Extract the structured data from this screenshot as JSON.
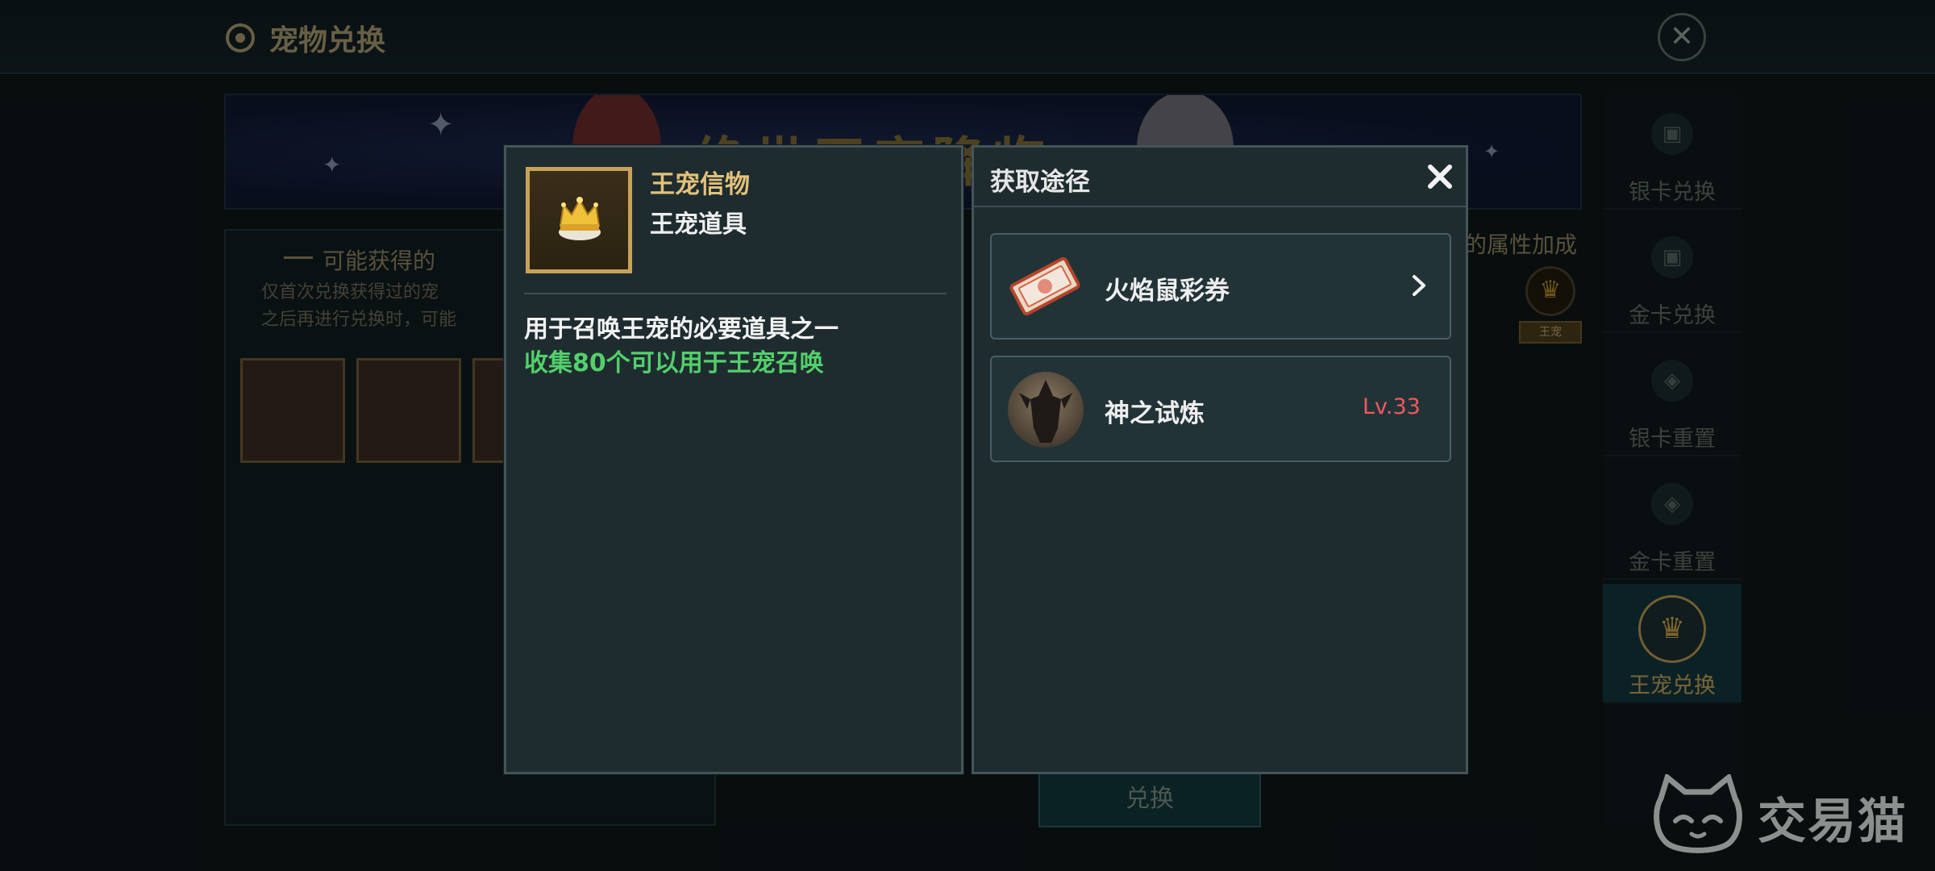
{
  "background": {
    "title": "宠物兑换",
    "banner_title": "绝世王宠降临",
    "panel_title": "可能获得的",
    "panel_note_lines": [
      "仅首次兑换获得过的宠",
      "之后再进行兑换时，可能"
    ],
    "attr_label": "的属性加成",
    "attr_tag": "王宠",
    "exchange_button": "兑换",
    "side_nav": [
      {
        "label": "银卡兑换",
        "icon": "silver-card-icon",
        "active": false
      },
      {
        "label": "金卡兑换",
        "icon": "gold-card-icon",
        "active": false
      },
      {
        "label": "银卡重置",
        "icon": "silver-reset-icon",
        "active": false
      },
      {
        "label": "金卡重置",
        "icon": "gold-reset-icon",
        "active": false
      },
      {
        "label": "王宠兑换",
        "icon": "crown-icon",
        "active": true
      }
    ]
  },
  "item": {
    "name": "王宠信物",
    "type": "王宠道具",
    "description": "用于召唤王宠的必要道具之一",
    "collect_text": "收集80个可以用于王宠召唤"
  },
  "source": {
    "title": "获取途径",
    "rows": [
      {
        "label": "火焰鼠彩券",
        "icon": "ticket-icon",
        "level": ""
      },
      {
        "label": "神之试炼",
        "icon": "trial-icon",
        "level": "Lv.33"
      }
    ]
  },
  "watermark": {
    "text": "交易猫"
  },
  "colors": {
    "item_name": "#e2c17a",
    "collect_text": "#52d06a",
    "level_text": "#f05a5a",
    "dialog_bg": "#1e2c30"
  }
}
